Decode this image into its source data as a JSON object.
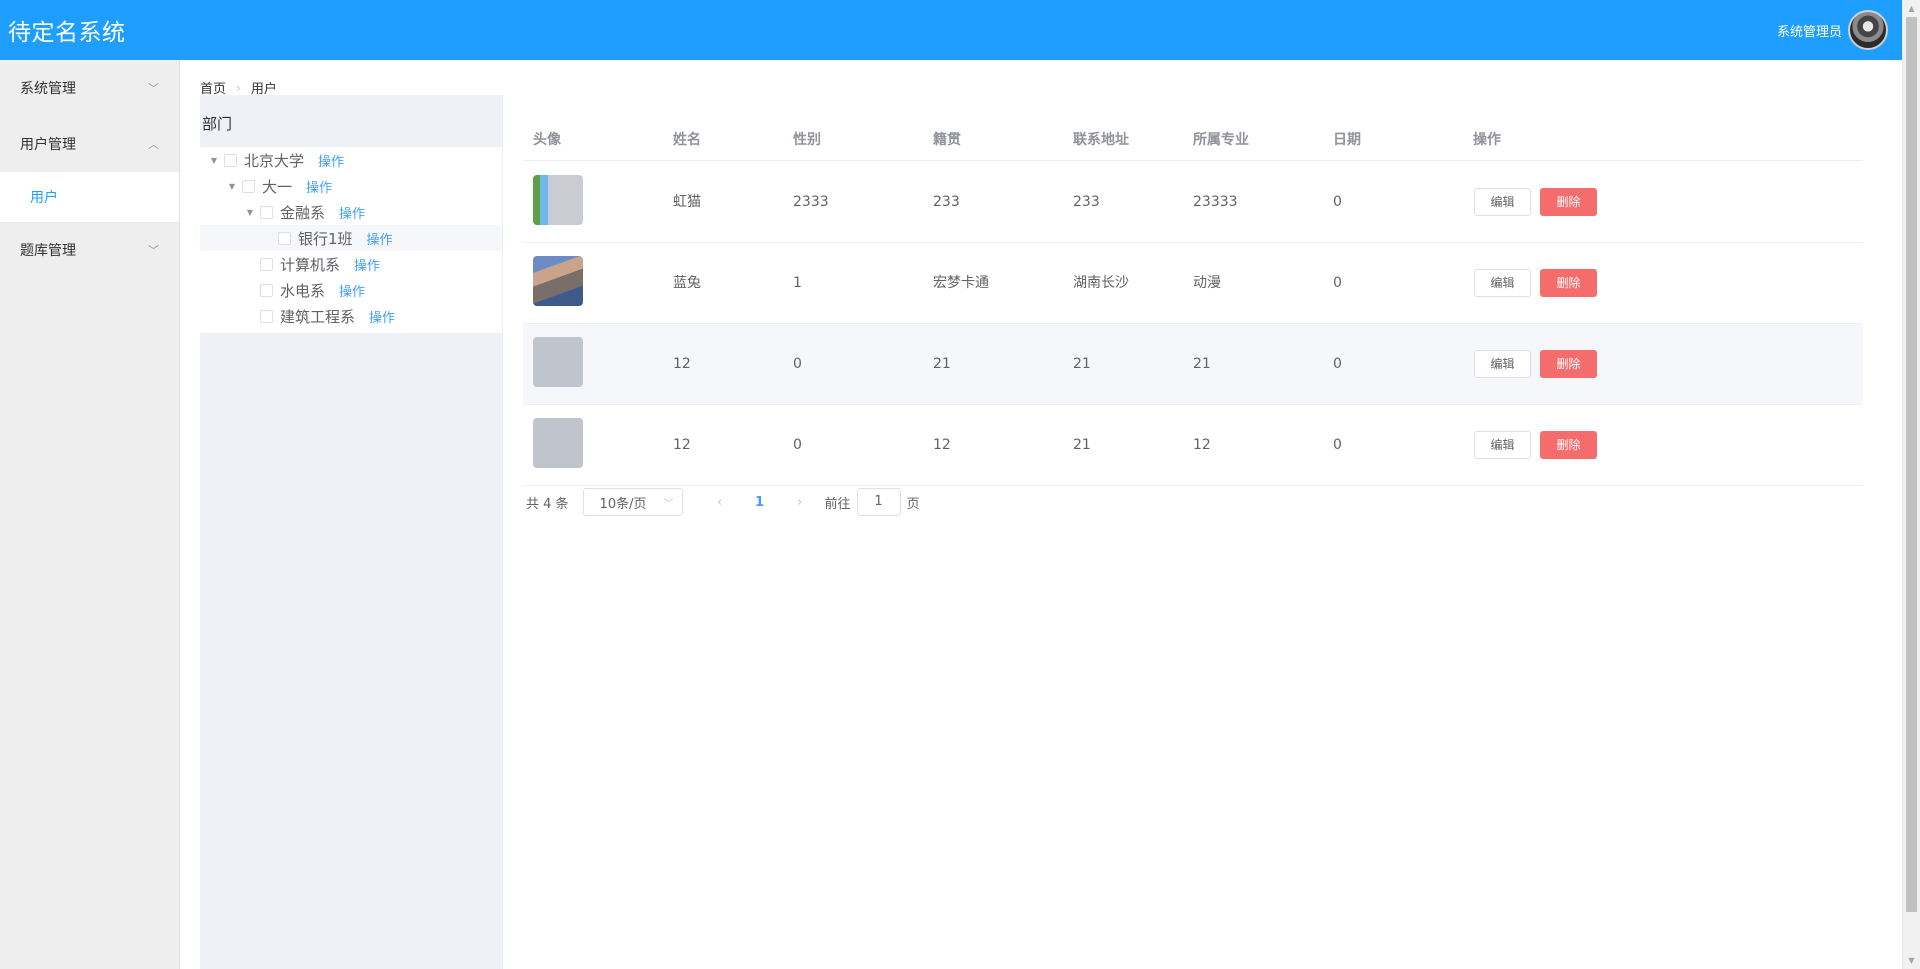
{
  "app": {
    "title": "待定名系统"
  },
  "header": {
    "user_name": "系统管理员"
  },
  "sidebar": {
    "items": [
      {
        "label": "系统管理"
      },
      {
        "label": "用户管理",
        "children": [
          {
            "label": "用户"
          }
        ]
      },
      {
        "label": "题库管理"
      }
    ]
  },
  "breadcrumb": {
    "home": "首页",
    "current": "用户"
  },
  "dept": {
    "title": "部门",
    "op_label": "操作",
    "nodes": [
      {
        "label": "北京大学"
      },
      {
        "label": "大一"
      },
      {
        "label": "金融系"
      },
      {
        "label": "银行1班"
      },
      {
        "label": "计算机系"
      },
      {
        "label": "水电系"
      },
      {
        "label": "建筑工程系"
      }
    ]
  },
  "table": {
    "columns": [
      "头像",
      "姓名",
      "性别",
      "籍贯",
      "联系地址",
      "所属专业",
      "日期",
      "操作"
    ],
    "rows": [
      {
        "name": "虹猫",
        "gender": "2333",
        "native": "233",
        "address": "233",
        "major": "23333",
        "date": "0"
      },
      {
        "name": "蓝兔",
        "gender": "1",
        "native": "宏梦卡通",
        "address": "湖南长沙",
        "major": "动漫",
        "date": "0"
      },
      {
        "name": "12",
        "gender": "0",
        "native": "21",
        "address": "21",
        "major": "21",
        "date": "0"
      },
      {
        "name": "12",
        "gender": "0",
        "native": "12",
        "address": "21",
        "major": "12",
        "date": "0"
      }
    ],
    "edit_label": "编辑",
    "delete_label": "删除"
  },
  "pagination": {
    "total": "共 4 条",
    "page_size": "10条/页",
    "current_page": "1",
    "goto_label": "前往",
    "goto_value": "1",
    "page_suffix": "页"
  },
  "colors": {
    "header": "#1e9fff",
    "accent": "#409eff",
    "danger": "#f56c6c"
  }
}
